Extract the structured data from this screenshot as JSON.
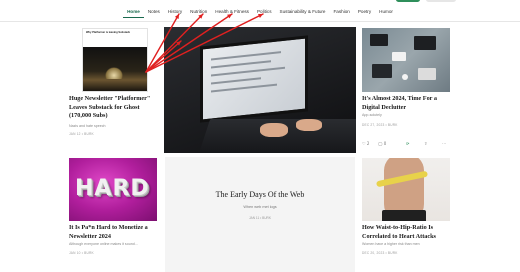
{
  "nav": {
    "items": [
      "Home",
      "Notes",
      "History",
      "Nutrition",
      "Health & Fitness",
      "Politics",
      "Sustainability & Future",
      "Fashion",
      "Poetry",
      "Humor"
    ],
    "active": "Home"
  },
  "cards": {
    "platformer": {
      "thumb_title": "Why Platformer is leaving Substack",
      "title": "Huge Newsletter \"Platformer\" Leaves Substack for Ghost (170,000 Subs)",
      "subtitle": "Nazis and hate speech",
      "meta": "JAN 12 • BURK"
    },
    "declutter": {
      "title": "It's Almost 2024, Time For a Digital Declutter",
      "subtitle": "App-solutely",
      "meta": "DEC 27, 2023 • BURK",
      "likes": "2",
      "comments": "0"
    },
    "monetize": {
      "image_text": "HARD",
      "title": "It Is Pa*n Hard to Monetize a Newsletter 2024",
      "subtitle": "Although everyone online makes it sound...",
      "meta": "JAN 10 • BURK"
    },
    "early_days": {
      "title": "The Early Days Of the Web",
      "subtitle": "When web met logs",
      "meta": "JAN 11 • BURK"
    },
    "waist": {
      "title": "How Waist-to-Hip-Ratio Is Correlated to Heart Attacks",
      "subtitle": "Women have a higher risk than men",
      "meta": "DEC 20, 2023 • BURK"
    }
  },
  "annotation": {
    "arrow_color": "#e02020"
  },
  "colors": {
    "accent": "#1a6a4f"
  }
}
